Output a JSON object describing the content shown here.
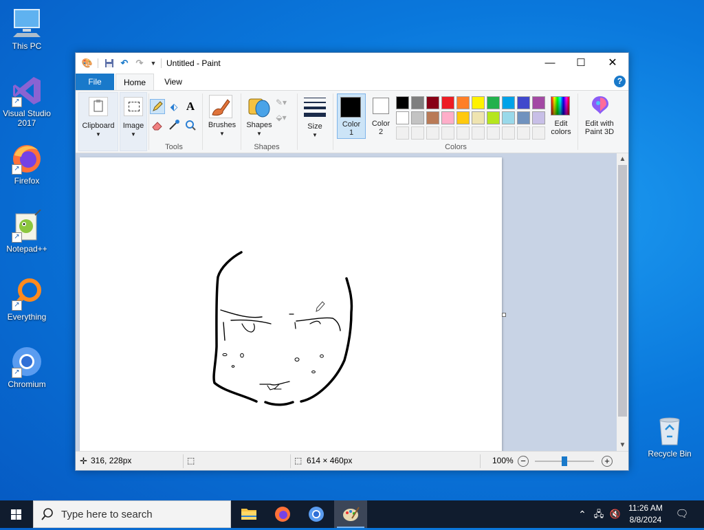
{
  "desktop": {
    "icons": [
      {
        "label": "This PC",
        "icon": "computer-icon"
      },
      {
        "label": "Visual Studio 2017",
        "icon": "visual-studio-icon"
      },
      {
        "label": "Firefox",
        "icon": "firefox-icon"
      },
      {
        "label": "Notepad++",
        "icon": "notepad-plus-plus-icon"
      },
      {
        "label": "Everything",
        "icon": "everything-search-icon"
      },
      {
        "label": "Chromium",
        "icon": "chromium-icon"
      }
    ],
    "recycle_bin": {
      "label": "Recycle Bin"
    }
  },
  "window": {
    "title": "Untitled - Paint",
    "tabs": {
      "file": "File",
      "home": "Home",
      "view": "View"
    },
    "ribbon": {
      "clipboard": "Clipboard",
      "image": "Image",
      "tools_group": "Tools",
      "brushes": "Brushes",
      "shapes": "Shapes",
      "shapes_group": "Shapes",
      "size": "Size",
      "color1": "Color",
      "color1_num": "1",
      "color2": "Color",
      "color2_num": "2",
      "colors_group": "Colors",
      "edit_colors_1": "Edit",
      "edit_colors_2": "colors",
      "paint3d_1": "Edit with",
      "paint3d_2": "Paint 3D"
    },
    "palette": {
      "row1": [
        "#000000",
        "#7f7f7f",
        "#880015",
        "#ed1c24",
        "#ff7f27",
        "#fff200",
        "#22b14c",
        "#00a2e8",
        "#3f48cc",
        "#a349a4"
      ],
      "row2": [
        "#ffffff",
        "#c3c3c3",
        "#b97a57",
        "#ffaec9",
        "#ffc90e",
        "#efe4b0",
        "#b5e61d",
        "#99d9ea",
        "#7092be",
        "#c8bfe7"
      ],
      "color1": "#000000",
      "color2": "#ffffff"
    },
    "status": {
      "cursor_pos": "316, 228px",
      "canvas_size": "614 × 460px",
      "zoom": "100%",
      "zoom_slider_fraction": 0.5
    }
  },
  "taskbar": {
    "search_placeholder": "Type here to search",
    "time": "11:26 AM",
    "date": "8/8/2024"
  }
}
